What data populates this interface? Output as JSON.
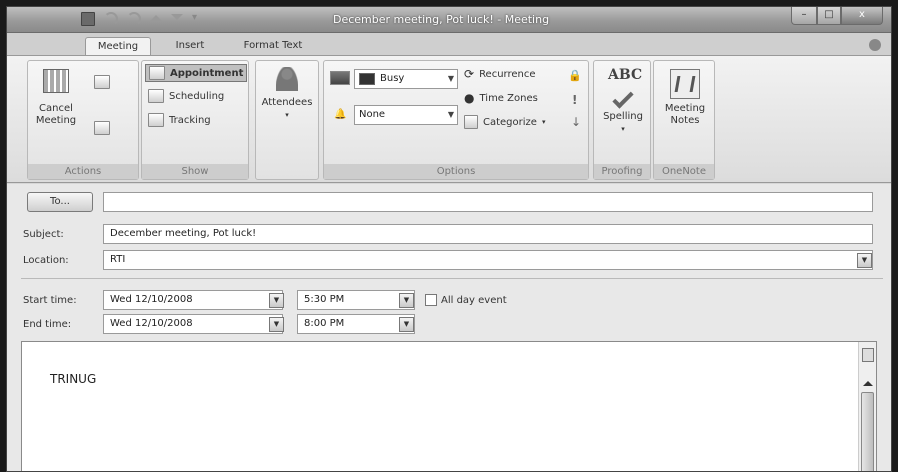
{
  "window": {
    "title": "December meeting, Pot luck! - Meeting",
    "controls": {
      "minimize": "–",
      "maximize": "□",
      "close": "x"
    }
  },
  "tabs": [
    {
      "label": "Meeting"
    },
    {
      "label": "Insert"
    },
    {
      "label": "Format Text"
    }
  ],
  "ribbon": {
    "actions": {
      "group_label": "Actions",
      "cancel_label": "Cancel\nMeeting"
    },
    "show": {
      "group_label": "Show",
      "appointment": "Appointment",
      "scheduling": "Scheduling",
      "tracking": "Tracking"
    },
    "attendees": {
      "label": "Attendees"
    },
    "options": {
      "group_label": "Options",
      "show_as": "Busy",
      "reminder": "None",
      "recurrence": "Recurrence",
      "time_zones": "Time Zones",
      "categorize": "Categorize"
    },
    "proofing": {
      "group_label": "Proofing",
      "spelling": "Spelling",
      "abc": "ABC"
    },
    "onenote": {
      "group_label": "OneNote",
      "meeting_notes": "Meeting\nNotes"
    }
  },
  "form": {
    "to_button": "To...",
    "to_value": "",
    "subject_label": "Subject:",
    "subject_value": "December meeting, Pot luck!",
    "location_label": "Location:",
    "location_value": "RTI",
    "start_label": "Start time:",
    "start_date": "Wed 12/10/2008",
    "start_time": "5:30 PM",
    "all_day_label": "All day event",
    "all_day_checked": false,
    "end_label": "End time:",
    "end_date": "Wed 12/10/2008",
    "end_time": "8:00 PM",
    "body": "TRINUG"
  }
}
